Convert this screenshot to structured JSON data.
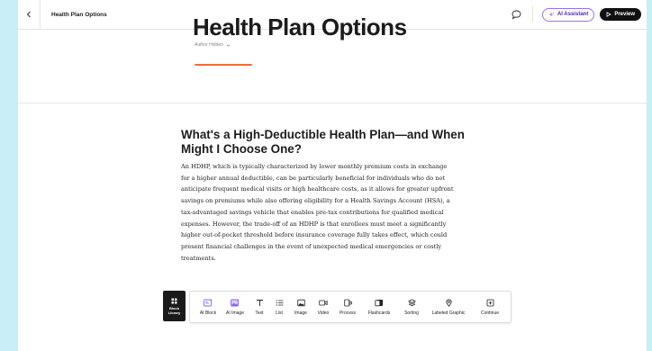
{
  "topbar": {
    "title": "Health Plan Options",
    "ai_assistant_label": "AI Assistant",
    "preview_label": "Preview"
  },
  "header": {
    "title": "Health Plan Options",
    "author": "Author Hidden"
  },
  "section": {
    "heading_lines": [
      "What's a High-Deductible Health Plan—and When",
      "Might I Choose One?"
    ],
    "body_lines": [
      "An HDHP, which is typically characterized by lower monthly premium costs in exchange",
      "for a higher annual deductible, can be particularly beneficial for individuals who do not",
      "anticipate frequent medical visits or high healthcare costs, as it allows for greater upfront",
      "savings on premiums while also offering eligibility for a Health Savings Account (HSA), a",
      "tax-advantaged savings vehicle that enables pre-tax contributions for qualified medical",
      "expenses. However, the trade-off of an HDHP is that enrollees must meet a significantly",
      "higher out-of-pocket threshold before insurance coverage fully takes effect, which could",
      "present financial challenges in the event of unexpected medical emergencies or costly",
      "treatments."
    ]
  },
  "block_library": {
    "label_line1": "Block",
    "label_line2": "Library"
  },
  "block_toolbar": {
    "items": [
      {
        "label": "AI Block",
        "icon": "ai-block-icon"
      },
      {
        "label": "AI Image",
        "icon": "ai-image-icon"
      },
      {
        "label": "Text",
        "icon": "text-icon"
      },
      {
        "label": "List",
        "icon": "list-icon"
      },
      {
        "label": "Image",
        "icon": "image-icon"
      },
      {
        "label": "Video",
        "icon": "video-icon"
      },
      {
        "label": "Process",
        "icon": "process-icon"
      },
      {
        "label": "Flashcards",
        "icon": "flashcards-icon"
      },
      {
        "label": "Sorting",
        "icon": "sorting-icon"
      },
      {
        "label": "Labeled Graphic",
        "icon": "labeled-graphic-icon"
      },
      {
        "label": "Continue",
        "icon": "continue-icon"
      }
    ]
  },
  "colors": {
    "accent": "#f26b3a",
    "ai_purple": "#9b6ef0",
    "background_frame": "#c9eef8"
  }
}
